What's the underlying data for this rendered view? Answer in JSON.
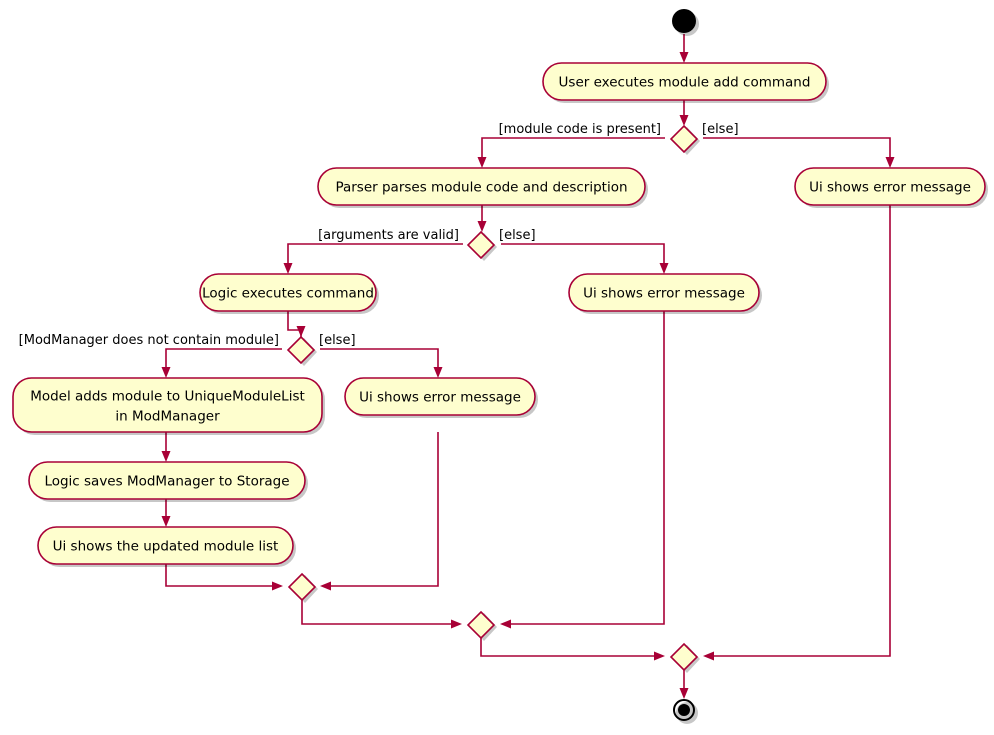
{
  "diagram": {
    "type": "uml-activity-diagram",
    "title": "Module add command activity diagram",
    "colors": {
      "node_fill": "#FEFECE",
      "node_stroke": "#A80036",
      "edge": "#A80036",
      "text": "#000000",
      "background": "#FFFFFF"
    },
    "start_node": {
      "label": "start"
    },
    "end_node": {
      "label": "end"
    },
    "activities": [
      {
        "id": "a1",
        "text": "User executes module add command",
        "lines": [
          "User executes module add command"
        ]
      },
      {
        "id": "a2",
        "text": "Parser parses module code and description",
        "lines": [
          "Parser parses module code and description"
        ]
      },
      {
        "id": "a3",
        "text": "Ui shows error message",
        "lines": [
          "Ui shows error message"
        ]
      },
      {
        "id": "a4",
        "text": "Logic executes command",
        "lines": [
          "Logic executes command"
        ]
      },
      {
        "id": "a5",
        "text": "Ui shows error message",
        "lines": [
          "Ui shows error message"
        ]
      },
      {
        "id": "a6",
        "text": "Model adds module to UniqueModuleList in ModManager",
        "lines": [
          "Model adds module to UniqueModuleList",
          "in ModManager"
        ]
      },
      {
        "id": "a7",
        "text": "Ui shows error message",
        "lines": [
          "Ui shows error message"
        ]
      },
      {
        "id": "a8",
        "text": "Logic saves ModManager to Storage",
        "lines": [
          "Logic saves ModManager to Storage"
        ]
      },
      {
        "id": "a9",
        "text": "Ui shows the updated module list",
        "lines": [
          "Ui shows the updated module list"
        ]
      }
    ],
    "decisions": [
      {
        "id": "d1",
        "yes_guard": "[module code is present]",
        "no_guard": "[else]"
      },
      {
        "id": "d2",
        "yes_guard": "[arguments are valid]",
        "no_guard": "[else]"
      },
      {
        "id": "d3",
        "yes_guard": "[ModManager does not contain module]",
        "no_guard": "[else]"
      }
    ],
    "merges": [
      {
        "id": "m1"
      },
      {
        "id": "m2"
      },
      {
        "id": "m3"
      }
    ]
  }
}
